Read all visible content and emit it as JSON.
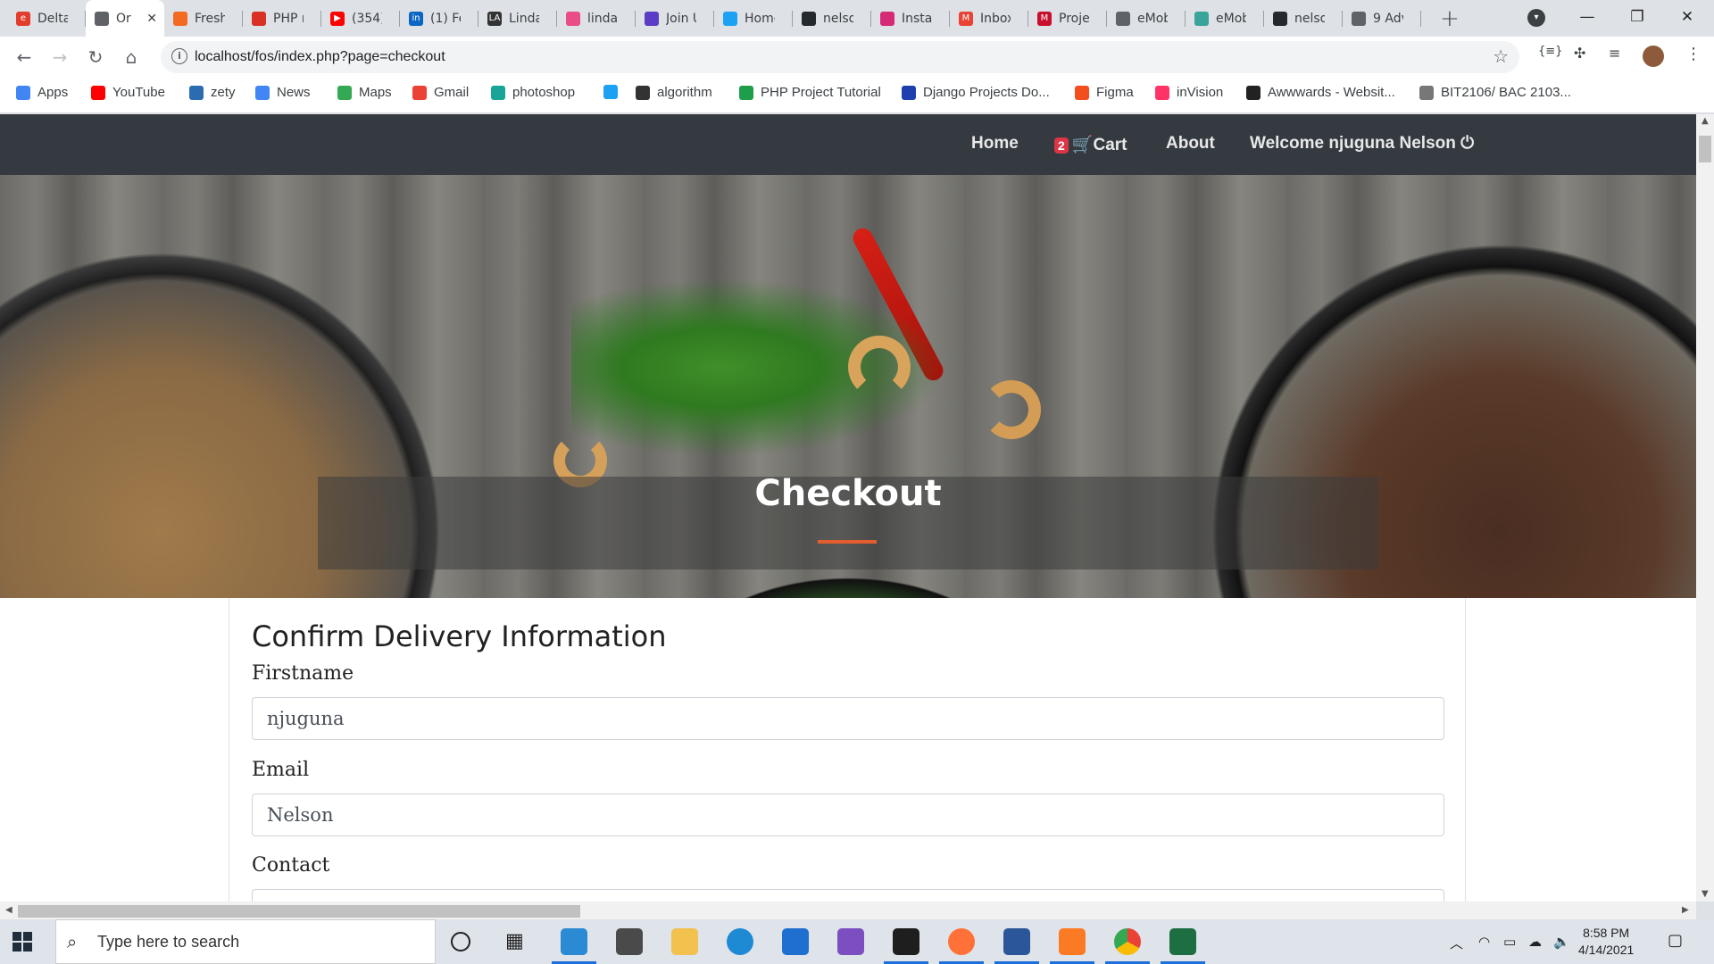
{
  "browser": {
    "tabs": [
      {
        "title": "Delta",
        "color": "#e23c2d",
        "glyph": "e"
      },
      {
        "title": "Or",
        "color": "#5f6368",
        "glyph": "",
        "active": true
      },
      {
        "title": "Fresh",
        "color": "#f26b21",
        "glyph": ""
      },
      {
        "title": "PHP r",
        "color": "#d93025",
        "glyph": ""
      },
      {
        "title": "(354)",
        "color": "#ff0000",
        "glyph": "▶"
      },
      {
        "title": "(1) Fe",
        "color": "#0a66c2",
        "glyph": "in"
      },
      {
        "title": "Linda",
        "color": "#333333",
        "glyph": "LA"
      },
      {
        "title": "linda",
        "color": "#ea4c89",
        "glyph": ""
      },
      {
        "title": "Join U",
        "color": "#5b3cc4",
        "glyph": ""
      },
      {
        "title": "Home",
        "color": "#1da1f2",
        "glyph": ""
      },
      {
        "title": "nelso",
        "color": "#24292e",
        "glyph": ""
      },
      {
        "title": "Instag",
        "color": "#d62976",
        "glyph": ""
      },
      {
        "title": "Inbox",
        "color": "#ea4335",
        "glyph": "M"
      },
      {
        "title": "Proje",
        "color": "#c8102e",
        "glyph": "M"
      },
      {
        "title": "eMob",
        "color": "#5f6368",
        "glyph": ""
      },
      {
        "title": "eMob",
        "color": "#3aa39a",
        "glyph": ""
      },
      {
        "title": "nelso",
        "color": "#24292e",
        "glyph": ""
      },
      {
        "title": "9 Adv",
        "color": "#5f6368",
        "glyph": ""
      }
    ],
    "url": "localhost/fos/index.php?page=checkout",
    "bookmarks": [
      {
        "label": "Apps",
        "color": "#4285f4"
      },
      {
        "label": "YouTube",
        "color": "#ff0000"
      },
      {
        "label": "zety",
        "color": "#2b6cb0"
      },
      {
        "label": "News",
        "color": "#4285f4"
      },
      {
        "label": "Maps",
        "color": "#34a853"
      },
      {
        "label": "Gmail",
        "color": "#ea4335"
      },
      {
        "label": "photoshop",
        "color": "#18a497"
      },
      {
        "label": "",
        "color": "#1da1f2"
      },
      {
        "label": "algorithm",
        "color": "#333333"
      },
      {
        "label": "PHP Project Tutorial",
        "color": "#1e9e4a"
      },
      {
        "label": "Django Projects Do...",
        "color": "#1e40af"
      },
      {
        "label": "Figma",
        "color": "#f24e1e"
      },
      {
        "label": "inVision",
        "color": "#ff3366"
      },
      {
        "label": "Awwwards - Websit...",
        "color": "#222222"
      },
      {
        "label": "BIT2106/ BAC 2103...",
        "color": "#777777"
      }
    ]
  },
  "site": {
    "nav": {
      "home": "Home",
      "cart_count": "2",
      "cart": "Cart",
      "about": "About",
      "welcome": "Welcome njuguna Nelson"
    },
    "hero_title": "Checkout",
    "form": {
      "title": "Confirm Delivery Information",
      "firstname_label": "Firstname",
      "firstname_value": "njuguna",
      "email_label": "Email",
      "email_value": "Nelson",
      "contact_label": "Contact",
      "contact_value": ""
    }
  },
  "taskbar": {
    "search_placeholder": "Type here to search",
    "time": "8:58 PM",
    "date": "4/14/2021"
  },
  "colors": {
    "nav_bg": "#343a40",
    "accent_rule": "#e35d2f",
    "cart_badge": "#dc3545"
  }
}
